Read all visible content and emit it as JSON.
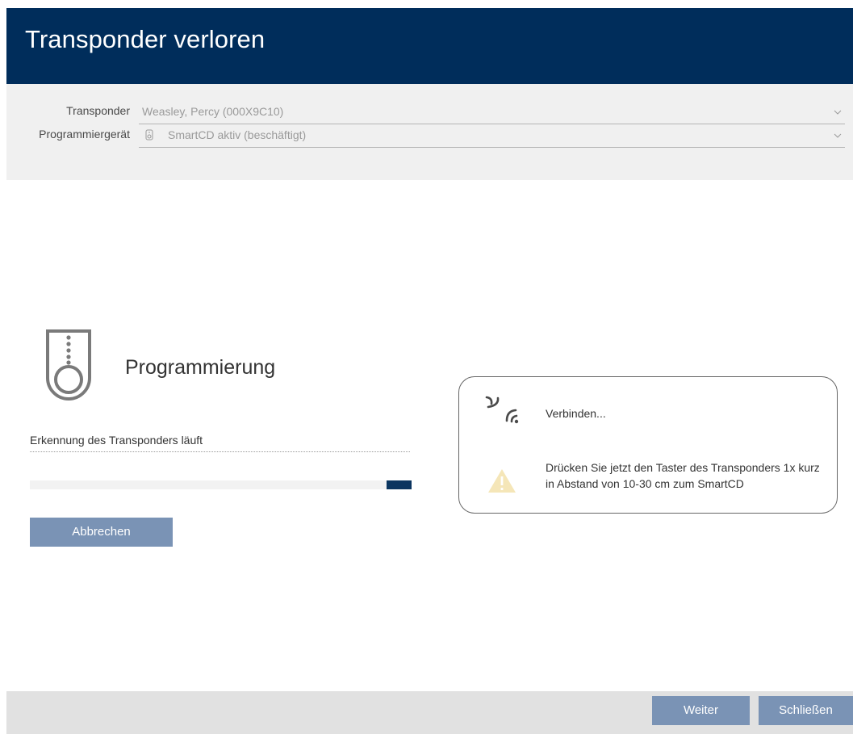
{
  "window": {
    "title": "Transponder verloren"
  },
  "fields": {
    "transponder": {
      "label": "Transponder",
      "value": "Weasley, Percy (000X9C10)",
      "icon": "chevron-down-icon"
    },
    "programmer": {
      "label": "Programmiergerät",
      "value": "SmartCD aktiv (beschäftigt)",
      "icon": "chevron-down-icon",
      "device_icon": "smartcd-device-icon"
    }
  },
  "programming": {
    "title": "Programmierung",
    "status_text": "Erkennung des Transponders läuft",
    "progress_style": "indeterminate",
    "cancel_label": "Abbrechen"
  },
  "info_panel": {
    "connect_text": "Verbinden...",
    "instruction_text": "Drücken Sie jetzt den Taster des Transponders 1x kurz in Abstand von 10-30 cm zum SmartCD"
  },
  "footer": {
    "next_label": "Weiter",
    "close_label": "Schließen"
  },
  "colors": {
    "header": "#002d5b",
    "button": "#7a93b5",
    "progress": "#0b3560",
    "warning": "#f5e6b8"
  }
}
